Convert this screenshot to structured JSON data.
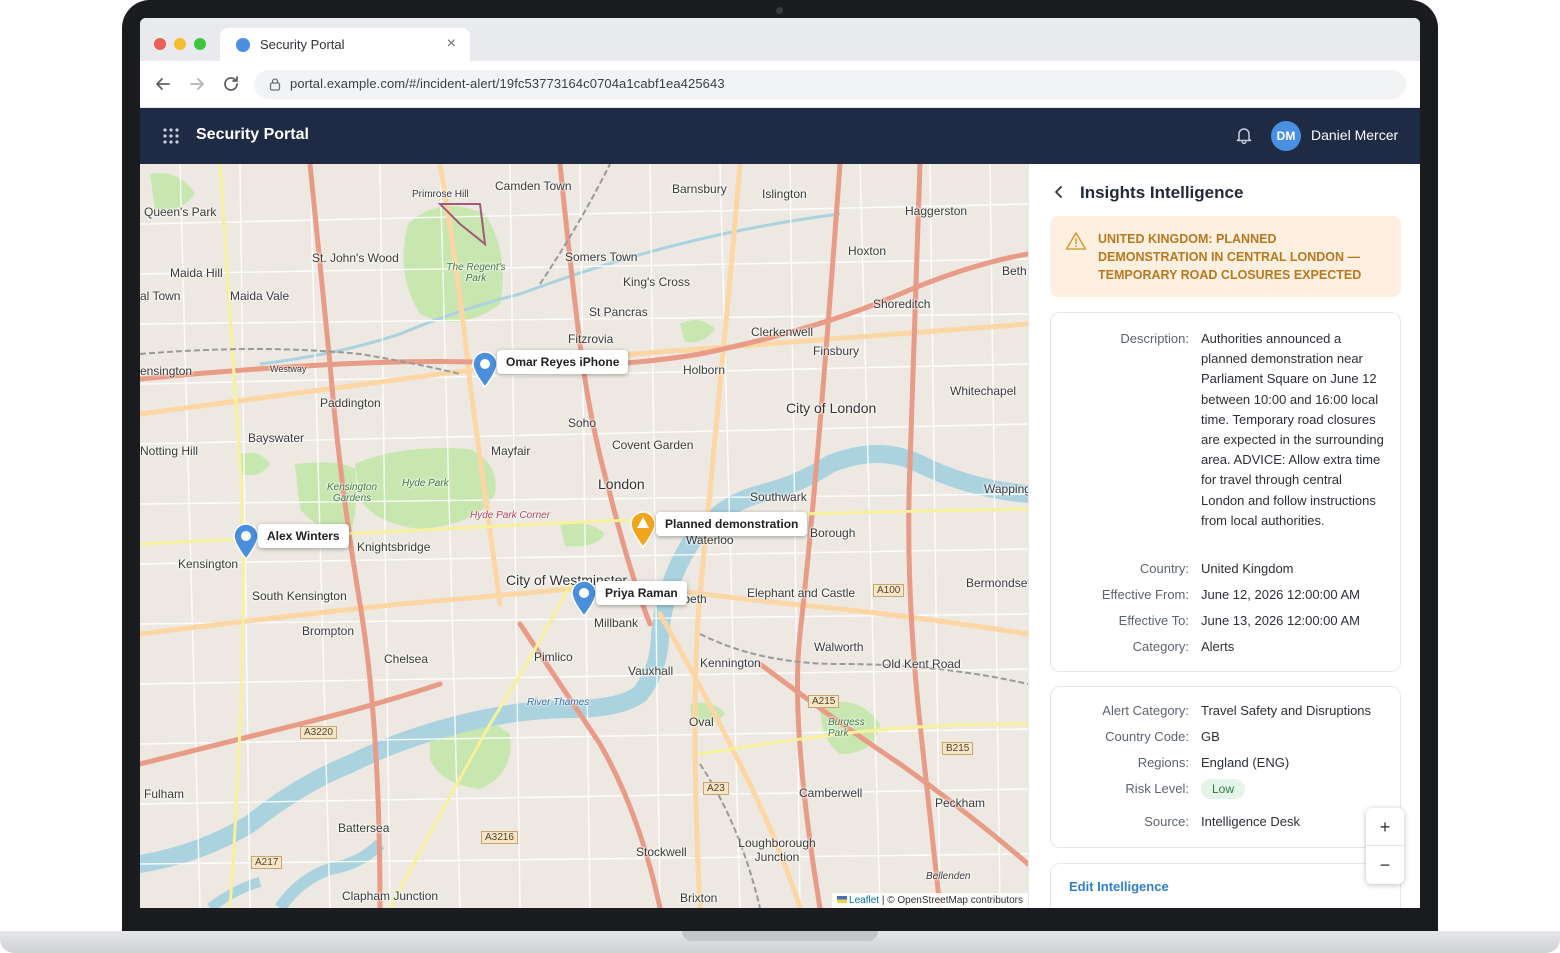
{
  "browser": {
    "tab_title": "Security Portal",
    "url": "portal.example.com/#/incident-alert/19fc53773164c0704a1cabf1ea425643"
  },
  "app": {
    "title": "Security Portal",
    "user_initials": "DM",
    "user_name": "Daniel Mercer"
  },
  "map": {
    "places": [
      "Camden Town",
      "Barnsbury",
      "Islington",
      "Haggerston",
      "Queen's Park",
      "Primrose Hill",
      "St. John's Wood",
      "Somers Town",
      "King's Cross",
      "Hoxton",
      "Maida Hill",
      "Maida Vale",
      "St Pancras",
      "Shoreditch",
      "Clerkenwell",
      "Fitzrovia",
      "Finsbury",
      "Holborn",
      "Whitechapel",
      "Paddington",
      "City of London",
      "Bayswater",
      "Soho",
      "Covent Garden",
      "Notting Hill",
      "Mayfair",
      "London",
      "Southwark",
      "Kensington",
      "Knightsbridge",
      "Waterloo",
      "Borough",
      "City of Westminster",
      "Lambeth",
      "Elephant and Castle",
      "South Kensington",
      "Brompton",
      "Millbank",
      "Chelsea",
      "Pimlico",
      "Vauxhall",
      "Kennington",
      "Walworth",
      "Old Kent Road",
      "Oval",
      "Fulham",
      "Battersea",
      "Camberwell",
      "Peckham",
      "Stockwell",
      "Loughborough Junction",
      "Brixton",
      "Clapham Junction",
      "Bermondsey",
      "Wapping",
      "Westway",
      "Hyde Park Corner",
      "Hyde Park",
      "Kensington Gardens",
      "The Regent's Park",
      "River Thames",
      "Burgess Park",
      "Bellenden",
      "Beth",
      "al Town",
      "ensington"
    ],
    "road_shields": [
      "A100",
      "A215",
      "A3220",
      "A23",
      "A3216",
      "A217",
      "B215"
    ],
    "markers": [
      {
        "label": "Omar Reyes iPhone",
        "type": "person",
        "color": "#4a8fdb"
      },
      {
        "label": "Alex Winters",
        "type": "person",
        "color": "#4a8fdb"
      },
      {
        "label": "Priya Raman",
        "type": "person",
        "color": "#4a8fdb"
      },
      {
        "label": "Planned demonstration",
        "type": "incident",
        "color": "#f0a51c"
      }
    ],
    "attribution_leaflet": "Leaflet",
    "attribution_osm": "© OpenStreetMap contributors",
    "zoom_in": "+",
    "zoom_out": "−"
  },
  "panel": {
    "title": "Insights Intelligence",
    "alert_headline": "UNITED KINGDOM: PLANNED DEMONSTRATION IN CENTRAL LONDON — TEMPORARY ROAD CLOSURES EXPECTED",
    "details": {
      "description_label": "Description:",
      "description": "Authorities announced a planned demonstration near Parliament Square on June 12 between 10:00 and 16:00 local time. Temporary road closures are expected in the surrounding area. ADVICE: Allow extra time for travel through central London and follow instructions from local authorities.",
      "country_label": "Country:",
      "country": "United Kingdom",
      "effective_from_label": "Effective From:",
      "effective_from": "June 12, 2026 12:00:00 AM",
      "effective_to_label": "Effective To:",
      "effective_to": "June 13, 2026 12:00:00 AM",
      "category_label": "Category:",
      "category": "Alerts"
    },
    "meta": {
      "alert_category_label": "Alert Category:",
      "alert_category": "Travel Safety and Disruptions",
      "country_code_label": "Country Code:",
      "country_code": "GB",
      "regions_label": "Regions:",
      "regions": "England (ENG)",
      "risk_level_label": "Risk Level:",
      "risk_level": "Low",
      "source_label": "Source:",
      "source": "Intelligence Desk"
    },
    "edit_label": "Edit Intelligence"
  },
  "colors": {
    "header_bg": "#1f2a44",
    "alert_bg": "#fdf0e1",
    "alert_text": "#b7791f",
    "link": "#2f7fc6",
    "badge_bg": "#e4f4e8",
    "badge_text": "#2f7d44"
  }
}
